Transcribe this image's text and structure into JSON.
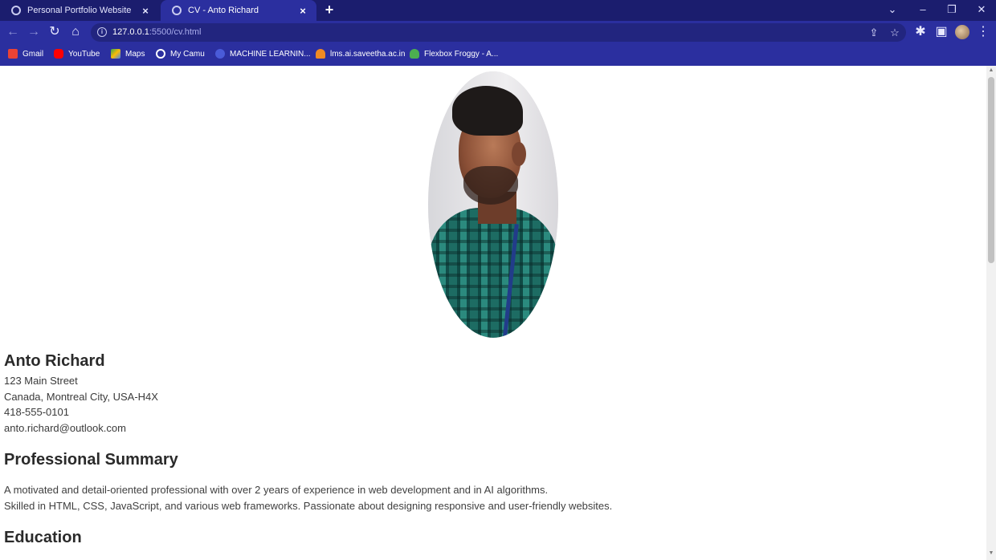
{
  "browser": {
    "tabs": [
      {
        "title": "Personal Portfolio Website",
        "active": false
      },
      {
        "title": "CV - Anto Richard",
        "active": true
      }
    ],
    "url_host": "127.0.0.1",
    "url_rest": ":5500/cv.html",
    "bookmarks": [
      {
        "label": "Gmail",
        "icon": "gmail-icon",
        "color": "#ea4335"
      },
      {
        "label": "YouTube",
        "icon": "youtube-icon",
        "color": "#ff0000"
      },
      {
        "label": "Maps",
        "icon": "maps-icon",
        "color": "#34a853"
      },
      {
        "label": "My Camu",
        "icon": "globe-icon",
        "color": "#ffffff"
      },
      {
        "label": "MACHINE LEARNIN...",
        "icon": "globe-icon",
        "color": "#4a5bd8"
      },
      {
        "label": "lms.ai.saveetha.ac.in",
        "icon": "lms-icon",
        "color": "#f08a24"
      },
      {
        "label": "Flexbox Froggy - A...",
        "icon": "frog-icon",
        "color": "#4caf50"
      }
    ],
    "accent": "#2b2f9f",
    "tabstrip_color": "#1b1d6e"
  },
  "cv": {
    "name": "Anto Richard",
    "contact": [
      "123 Main Street",
      "Canada, Montreal City, USA-H4X",
      "418-555-0101",
      "anto.richard@outlook.com"
    ],
    "summary_heading": "Professional Summary",
    "summary_lines": [
      "A motivated and detail-oriented professional with over 2 years of experience in web development and in AI algorithms.",
      "Skilled in HTML, CSS, JavaScript, and various web frameworks. Passionate about designing responsive and user-friendly websites."
    ],
    "education_heading": "Education"
  }
}
